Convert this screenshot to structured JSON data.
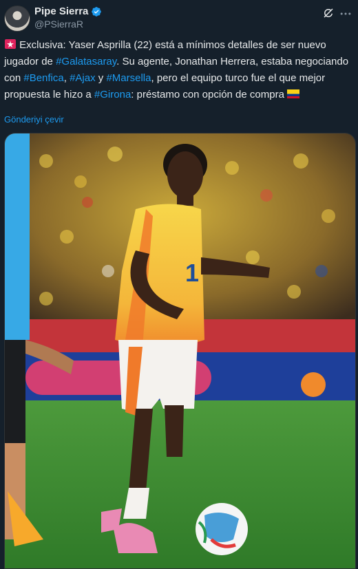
{
  "author": {
    "display_name": "Pipe Sierra",
    "handle": "@PSierraR",
    "verified": true
  },
  "icons": {
    "avatar": "avatar",
    "verified": "verified-badge-icon",
    "grok": "grok-icon",
    "more": "more-options-icon"
  },
  "tweet": {
    "p1": " Exclusiva: Yaser Asprilla (22) está a mínimos detalles de ser nuevo jugador de ",
    "tag_galatasaray": "#Galatasaray",
    "p2": ". Su agente, Jonathan Herrera, estaba negociando con ",
    "tag_benfica": "#Benfica",
    "p3": ", ",
    "tag_ajax": "#Ajax",
    "p4": " y ",
    "tag_marsella": "#Marsella",
    "p5": ", pero el equipo turco fue el que mejor propuesta le hizo a ",
    "tag_girona": "#Girona",
    "p6": ": préstamo con opción de compra "
  },
  "translate_label": "Gönderiyi çevir",
  "media": {
    "description_icon": "photo",
    "jersey_number": "1"
  }
}
